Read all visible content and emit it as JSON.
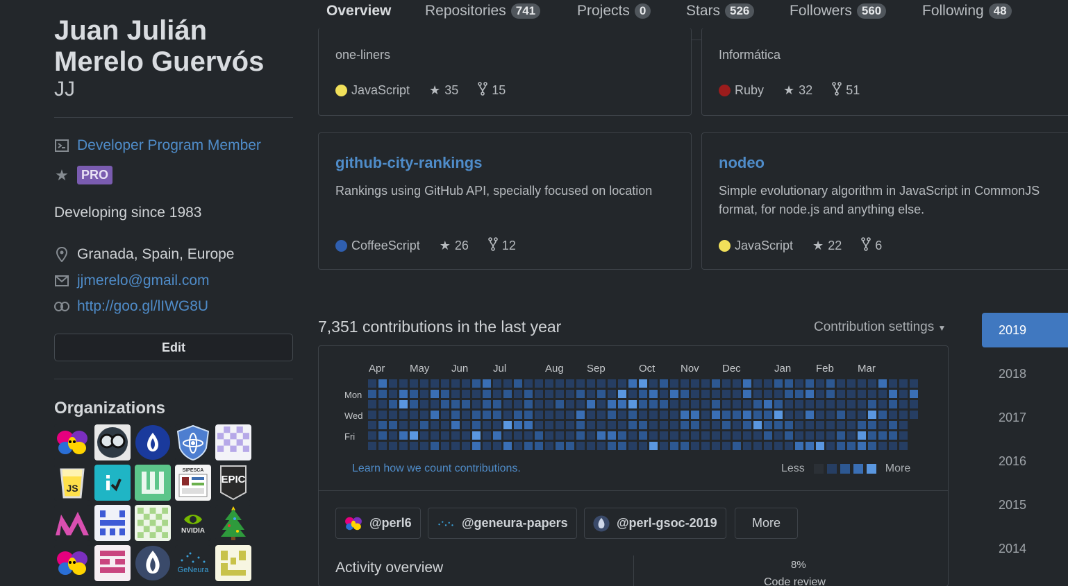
{
  "profile": {
    "name": "Juan Julián Merelo Guervós",
    "nickname": "JJ",
    "developer_program": "Developer Program Member",
    "pro_badge": "PRO",
    "bio": "Developing since 1983",
    "location": "Granada, Spain, Europe",
    "email": "jjmerelo@gmail.com",
    "website": "http://goo.gl/lIWG8U",
    "edit_label": "Edit",
    "organizations_title": "Organizations",
    "organizations": [
      {
        "icon": "perl6-butterfly-icon",
        "label": ""
      },
      {
        "icon": "goggles-icon",
        "label": ""
      },
      {
        "icon": "eu-perl-onion-icon",
        "label": ""
      },
      {
        "icon": "atom-shield-icon",
        "label": ""
      },
      {
        "icon": "purple-pattern-icon",
        "label": ""
      },
      {
        "icon": "js-cup-icon",
        "label": "JS"
      },
      {
        "icon": "cyan-logo-icon",
        "label": ""
      },
      {
        "icon": "green-crown-icon",
        "label": ""
      },
      {
        "icon": "sipesca-icon",
        "label": "SIPESCA"
      },
      {
        "icon": "epic-games-icon",
        "label": "EPIC"
      },
      {
        "icon": "m-logo-icon",
        "label": ""
      },
      {
        "icon": "blue-pattern-icon",
        "label": ""
      },
      {
        "icon": "green-pattern-icon",
        "label": ""
      },
      {
        "icon": "nvidia-icon",
        "label": "NVIDIA"
      },
      {
        "icon": "christmas-tree-icon",
        "label": ""
      },
      {
        "icon": "perl6-butterfly-icon",
        "label": ""
      },
      {
        "icon": "pink-pattern-icon",
        "label": ""
      },
      {
        "icon": "perl-onion-icon",
        "label": ""
      },
      {
        "icon": "geneura-icon",
        "label": "GeNeura"
      },
      {
        "icon": "yellow-pattern-icon",
        "label": ""
      }
    ]
  },
  "tabs": [
    {
      "label": "Overview",
      "count": null
    },
    {
      "label": "Repositories",
      "count": "741"
    },
    {
      "label": "Projects",
      "count": "0"
    },
    {
      "label": "Stars",
      "count": "526"
    },
    {
      "label": "Followers",
      "count": "560"
    },
    {
      "label": "Following",
      "count": "48"
    }
  ],
  "repos": [
    {
      "name": "",
      "desc": "one-liners",
      "lang": "JavaScript",
      "lang_color": "#f1e05a",
      "stars": "35",
      "forks": "15"
    },
    {
      "name": "",
      "desc": "Informática",
      "lang": "Ruby",
      "lang_color": "#9b1c1c",
      "stars": "32",
      "forks": "51"
    },
    {
      "name": "github-city-rankings",
      "desc": "Rankings using GitHub API, specially focused on location",
      "lang": "CoffeeScript",
      "lang_color": "#2f5fb0",
      "stars": "26",
      "forks": "12"
    },
    {
      "name": "nodeo",
      "desc": "Simple evolutionary algorithm in JavaScript in CommonJS format, for node.js and anything else.",
      "lang": "JavaScript",
      "lang_color": "#f1e05a",
      "stars": "22",
      "forks": "6"
    }
  ],
  "contributions": {
    "title": "7,351 contributions in the last year",
    "settings_label": "Contribution settings",
    "months": [
      "Apr",
      "May",
      "Jun",
      "Jul",
      "Aug",
      "Sep",
      "Oct",
      "Nov",
      "Dec",
      "Jan",
      "Feb",
      "Mar"
    ],
    "days": [
      "Mon",
      "Wed",
      "Fri"
    ],
    "learn_link": "Learn how we count contributions.",
    "legend_less": "Less",
    "legend_more": "More",
    "legend_colors": [
      "#2b3036",
      "#263e63",
      "#2d5892",
      "#3a6fb5",
      "#5a97e0"
    ],
    "org_filters": [
      {
        "label": "@perl6",
        "icon": "perl6-butterfly-icon"
      },
      {
        "label": "@geneura-papers",
        "icon": "geneura-icon"
      },
      {
        "label": "@perl-gsoc-2019",
        "icon": "perl-onion-icon"
      }
    ],
    "more_label": "More",
    "activity_title": "Activity overview",
    "code_review_pct": "8%",
    "code_review_label": "Code review"
  },
  "years": [
    "2019",
    "2018",
    "2017",
    "2016",
    "2015",
    "2014"
  ],
  "selected_year": "2019"
}
